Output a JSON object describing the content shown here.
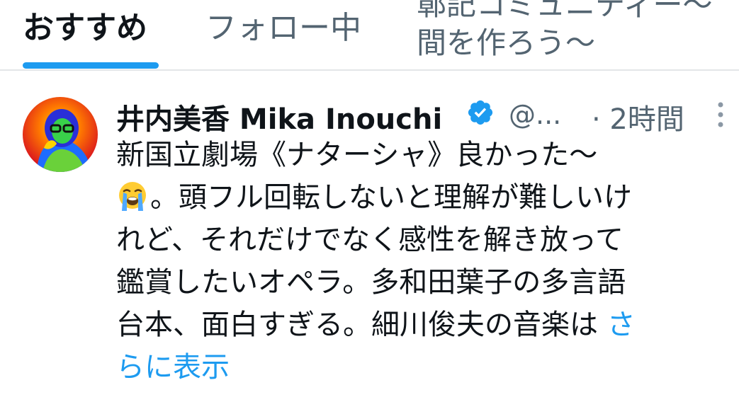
{
  "tabs": {
    "recommended": "おすすめ",
    "following": "フォロー中",
    "community_line1": "鄣記コミュニティー〜",
    "community_line2": "間を作ろう〜"
  },
  "post": {
    "author_name": "井内美香 Mika Inouchi",
    "handle": "@...",
    "time": "· 2時間",
    "body_line1": "新国立劇場《ナターシャ》良かった〜",
    "body_line2_after_emoji": "。頭フル回転しないと理解が難しいけ",
    "body_line3": "れど、それだけでなく感性を解き放って",
    "body_line4": "鑑賞したいオペラ。多和田葉子の多言語",
    "body_line5": "台本、面白すぎる。細川俊夫の音楽は ",
    "show_more_part1": "さ",
    "show_more_part2": "らに表示"
  },
  "icons": {
    "verified": "verified-badge-icon",
    "more": "more-vertical-icon",
    "emoji": "loudly-crying-face-emoji"
  },
  "colors": {
    "accent": "#1d9bf0",
    "text_primary": "#0f1419",
    "text_secondary": "#536471"
  }
}
